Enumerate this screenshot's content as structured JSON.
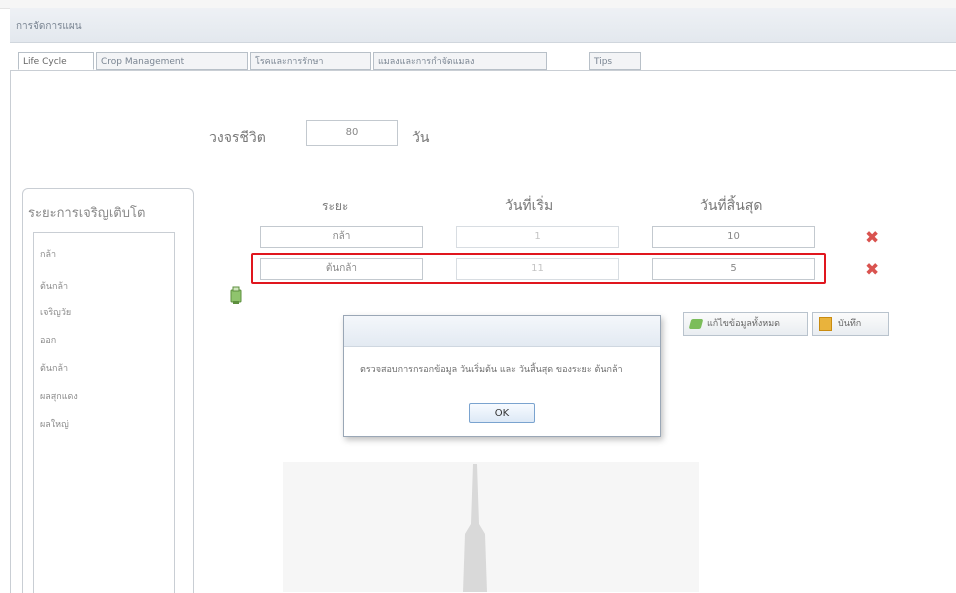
{
  "window": {
    "title": "การจัดการแผน"
  },
  "tabs": [
    {
      "label": "Life Cycle",
      "active": true
    },
    {
      "label": "Crop Management",
      "active": false
    },
    {
      "label": "โรคและการรักษา",
      "active": false
    },
    {
      "label": "แมลงและการกำจัดแมลง",
      "active": false
    },
    {
      "label": "Tips",
      "active": false
    }
  ],
  "lifecycle": {
    "label": "วงจรชีวิต",
    "value": "80",
    "unit": "วัน"
  },
  "sidebar": {
    "title": "ระยะการเจริญเติบโต",
    "items": [
      "กล้า",
      "ต้นกล้า",
      "เจริญวัย",
      "ออก",
      "ต้นกล้า",
      "ผลสุกแดง",
      "ผลใหญ่"
    ]
  },
  "table": {
    "headers": [
      "ระยะ",
      "วันที่เริ่ม",
      "วันที่สิ้นสุด"
    ],
    "rows": [
      {
        "stage": "กล้า",
        "start": "1",
        "end": "10"
      },
      {
        "stage": "ต้นกล้า",
        "start": "11",
        "end": "5"
      }
    ]
  },
  "buttons": {
    "edit_label": "แก้ไขข้อมูลทั้งหมด",
    "save_label": "บันทึก"
  },
  "dialog": {
    "message": "ตรวจสอบการกรอกข้อมูล วันเริ่มต้น และ วันสิ้นสุด ของระยะ ต้นกล้า",
    "ok_label": "OK"
  },
  "colors": {
    "highlight": "#e0161e",
    "delete": "#d9534f"
  }
}
